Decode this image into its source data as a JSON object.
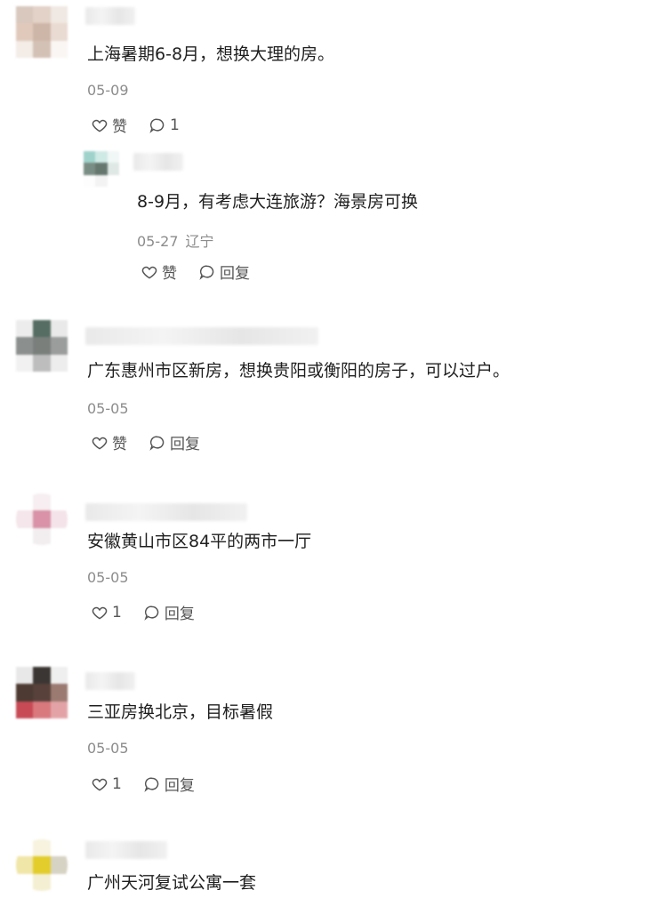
{
  "comments": [
    {
      "text": "上海暑期6-8月，想换大理的房。",
      "date": "05-09",
      "location": "",
      "like_label": "赞",
      "reply_label": "1"
    },
    {
      "text": "8-9月，有考虑大连旅游？海景房可换",
      "date": "05-27",
      "location": "辽宁",
      "like_label": "赞",
      "reply_label": "回复"
    },
    {
      "text": "广东惠州市区新房，想换贵阳或衡阳的房子，可以过户。",
      "date": "05-05",
      "location": "",
      "like_label": "赞",
      "reply_label": "回复"
    },
    {
      "text": "安徽黄山市区84平的两市一厅",
      "date": "05-05",
      "location": "",
      "like_label": "1",
      "reply_label": "回复"
    },
    {
      "text": "三亚房换北京，目标暑假",
      "date": "05-05",
      "location": "",
      "like_label": "1",
      "reply_label": "回复"
    },
    {
      "text": "广州天河复试公寓一套"
    }
  ],
  "icons": {
    "like": "heart-outline-icon",
    "reply": "speech-bubble-icon"
  },
  "colors": {
    "text": "#1f1f1f",
    "meta": "#8c8c8c",
    "action": "#555555"
  }
}
